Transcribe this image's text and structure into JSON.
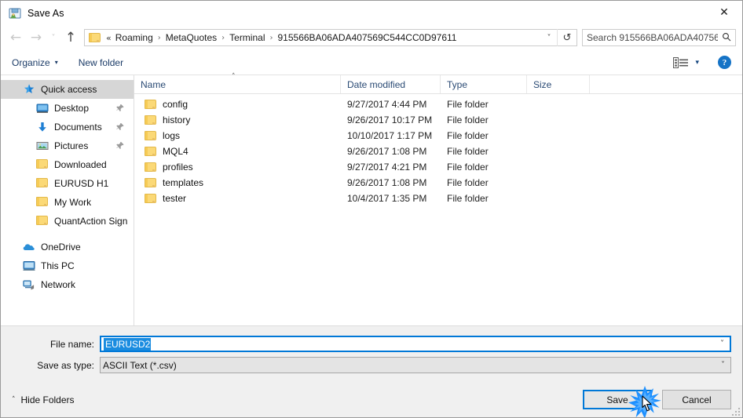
{
  "window": {
    "title": "Save As",
    "app_icon": "save-as-icon",
    "close_label": "✕"
  },
  "nav": {
    "back": "←",
    "forward": "→",
    "recent": "˅",
    "up": "↑",
    "refresh": "↺",
    "dropdown_caret": "˅",
    "breadcrumb_prefix": "«",
    "separator": "›",
    "crumbs": [
      "Roaming",
      "MetaQuotes",
      "Terminal",
      "915566BA06ADA407569C544CC0D97611"
    ]
  },
  "search": {
    "placeholder": "Search 915566BA06ADA40756...",
    "icon": "search-icon"
  },
  "toolbar": {
    "organize_label": "Organize",
    "organize_caret": "▾",
    "new_folder_label": "New folder",
    "view_caret": "▾",
    "help_label": "?"
  },
  "sidebar": {
    "items": [
      {
        "label": "Quick access",
        "icon": "star-icon",
        "level": 0,
        "selected": true,
        "pinned": false
      },
      {
        "label": "Desktop",
        "icon": "monitor-icon",
        "level": 1,
        "selected": false,
        "pinned": true
      },
      {
        "label": "Documents",
        "icon": "download-arrow-icon",
        "level": 1,
        "selected": false,
        "pinned": true
      },
      {
        "label": "Pictures",
        "icon": "picture-icon",
        "level": 1,
        "selected": false,
        "pinned": true
      },
      {
        "label": "Downloaded",
        "icon": "folder-icon",
        "level": 1,
        "selected": false,
        "pinned": false
      },
      {
        "label": "EURUSD H1",
        "icon": "folder-icon",
        "level": 1,
        "selected": false,
        "pinned": false
      },
      {
        "label": "My Work",
        "icon": "folder-icon",
        "level": 1,
        "selected": false,
        "pinned": false
      },
      {
        "label": "QuantAction Signal",
        "icon": "folder-icon",
        "level": 1,
        "selected": false,
        "pinned": false
      }
    ],
    "roots": [
      {
        "label": "OneDrive",
        "icon": "cloud-icon"
      },
      {
        "label": "This PC",
        "icon": "pc-icon"
      },
      {
        "label": "Network",
        "icon": "network-icon"
      }
    ]
  },
  "filelist": {
    "columns": [
      "Name",
      "Date modified",
      "Type",
      "Size"
    ],
    "sort_caret": "˄",
    "rows": [
      {
        "name": "config",
        "date": "9/27/2017 4:44 PM",
        "type": "File folder",
        "size": ""
      },
      {
        "name": "history",
        "date": "9/26/2017 10:17 PM",
        "type": "File folder",
        "size": ""
      },
      {
        "name": "logs",
        "date": "10/10/2017 1:17 PM",
        "type": "File folder",
        "size": ""
      },
      {
        "name": "MQL4",
        "date": "9/26/2017 1:08 PM",
        "type": "File folder",
        "size": ""
      },
      {
        "name": "profiles",
        "date": "9/27/2017 4:21 PM",
        "type": "File folder",
        "size": ""
      },
      {
        "name": "templates",
        "date": "9/26/2017 1:08 PM",
        "type": "File folder",
        "size": ""
      },
      {
        "name": "tester",
        "date": "10/4/2017 1:35 PM",
        "type": "File folder",
        "size": ""
      }
    ]
  },
  "form": {
    "filename_label": "File name:",
    "filename_value": "EURUSD2",
    "filetype_label": "Save as type:",
    "filetype_value": "ASCII Text (*.csv)",
    "caret": "˅"
  },
  "footer": {
    "hide_folders_label": "Hide Folders",
    "hide_folders_caret": "˄",
    "save_label": "Save",
    "cancel_label": "Cancel"
  },
  "colors": {
    "accent": "#0078d7",
    "selection": "#1a8ce0",
    "folder": "#fbd977",
    "header_text": "#2a4a74",
    "burst": "#1e90ff"
  }
}
